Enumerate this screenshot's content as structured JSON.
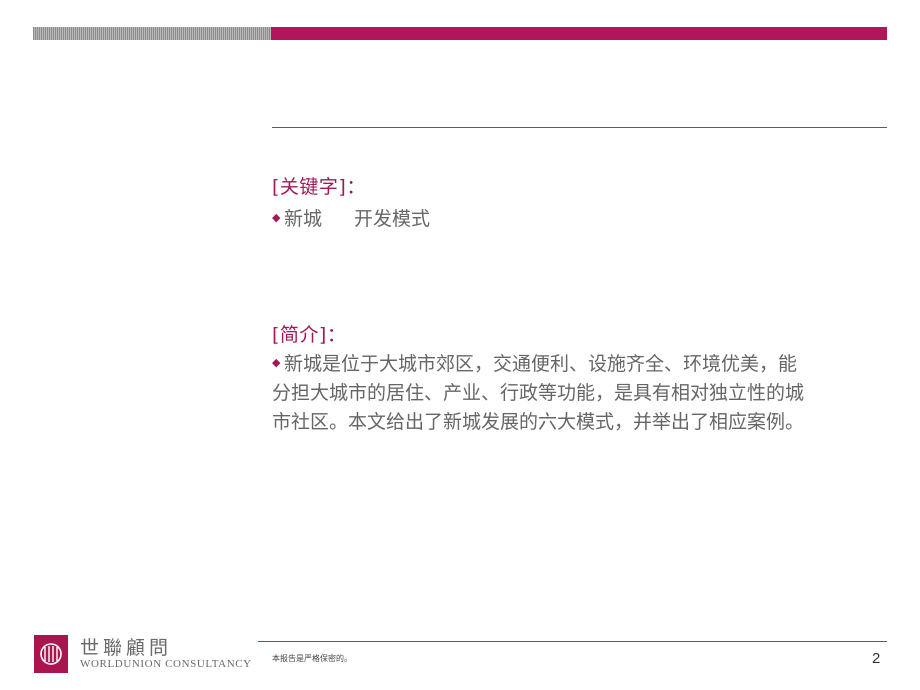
{
  "header": {
    "accent_color": "#b3155a"
  },
  "keywords": {
    "title": "[关键字]：",
    "bullet": "◆",
    "items": [
      "新城",
      "开发模式"
    ]
  },
  "intro": {
    "title": "[简介]：",
    "bullet": "◆",
    "lines": [
      "新城是位于大城市郊区，交通便利、设施齐全、环境优美，能",
      "分担大城市的居住、产业、行政等功能，是具有相对独立性的城",
      "市社区。本文给出了新城发展的六大模式，并举出了相应案例。"
    ]
  },
  "footer": {
    "logo_cn": "世聯顧問",
    "logo_en": "WORLDUNION CONSULTANCY",
    "note": "本报告是严格保密的。",
    "page_number": "2"
  }
}
